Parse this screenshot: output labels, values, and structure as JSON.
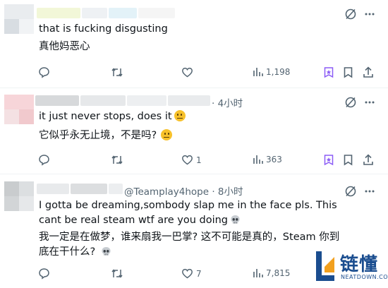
{
  "tweets": [
    {
      "meta": "",
      "lines": [
        "that is fucking disgusting",
        "真他妈恶心"
      ],
      "actions": {
        "replies": "",
        "retweets": "",
        "likes": "",
        "views": "1,198"
      }
    },
    {
      "meta": "· 4小时",
      "lines": [
        "it just never stops, does it",
        "它似乎永无止境，不是吗?"
      ],
      "actions": {
        "replies": "",
        "retweets": "",
        "likes": "1",
        "views": "363"
      }
    },
    {
      "meta": "@Teamplay4hope · 8小时",
      "lines": [
        "I gotta be dreaming,sombody slap me in the face pls. This cant be real steam wtf are you doing",
        "我一定是在做梦，谁来扇我一巴掌? 这不可能是真的，Steam 你到底在干什么?"
      ],
      "actions": {
        "replies": "",
        "retweets": "",
        "likes": "7",
        "views": "7,815"
      }
    }
  ],
  "watermark": {
    "cn": "链懂",
    "en": "NEATDOWN.COM"
  },
  "icons": [
    "grok-icon",
    "more-icon",
    "reply-icon",
    "retweet-icon",
    "like-icon",
    "views-icon",
    "tip-icon",
    "bookmark-icon",
    "share-icon",
    "slightly-frowning-face-emoji",
    "skull-emoji"
  ],
  "colors": {
    "text": "#0f1419",
    "muted": "#536471",
    "divider": "#eff3f4",
    "accent": "#8b5cf6",
    "watermark": "#1a4d8f"
  }
}
